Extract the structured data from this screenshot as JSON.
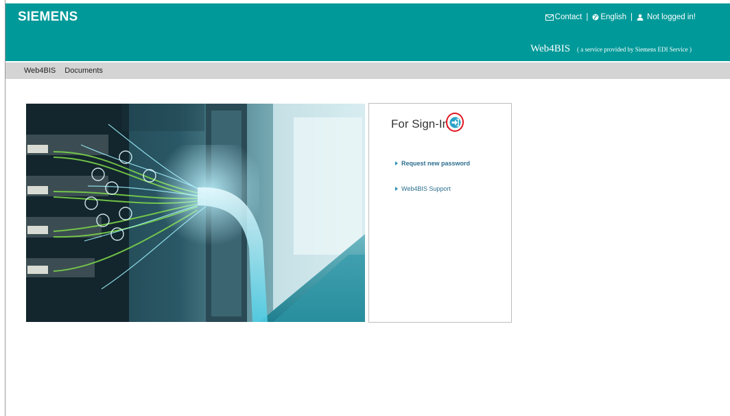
{
  "header": {
    "logo": "SIEMENS",
    "links": {
      "contact": "Contact",
      "language": "English",
      "login_status": "Not logged in!",
      "separator": "|"
    },
    "service_name": "Web4BIS",
    "service_sub": "( a service provided by Siemens EDI Service )"
  },
  "nav": {
    "items": [
      "Web4BIS",
      "Documents"
    ]
  },
  "panel": {
    "title": "For Sign-In",
    "links": [
      "Request new password",
      "Web4BIS Support"
    ]
  },
  "colors": {
    "brand": "#009999",
    "nav_bg": "#d4d4d4",
    "highlight_ring": "#e0141c",
    "link": "#2a6d8e"
  }
}
